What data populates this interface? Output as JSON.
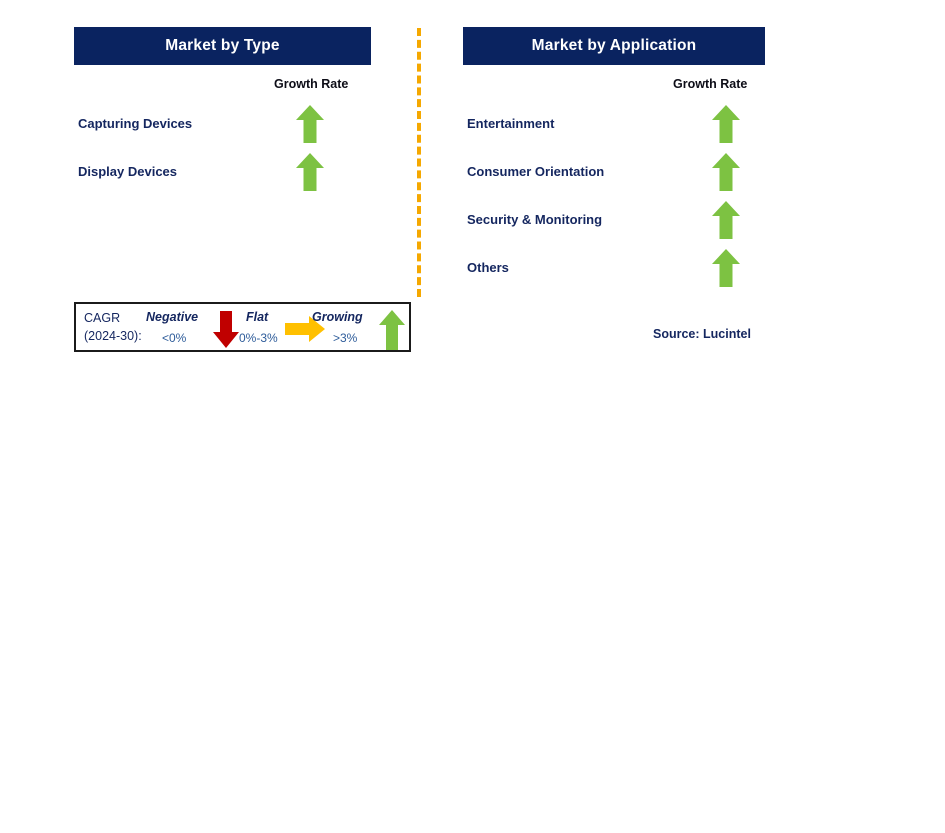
{
  "panels": [
    {
      "title": "Market by Type",
      "growth_rate_caption": "Growth Rate",
      "items": [
        {
          "label": "Capturing Devices",
          "trend": "growing",
          "trend_icon": "up-arrow-icon"
        },
        {
          "label": "Display Devices",
          "trend": "growing",
          "trend_icon": "up-arrow-icon"
        }
      ]
    },
    {
      "title": "Market by Application",
      "growth_rate_caption": "Growth Rate",
      "items": [
        {
          "label": "Entertainment",
          "trend": "growing",
          "trend_icon": "up-arrow-icon"
        },
        {
          "label": "Consumer Orientation",
          "trend": "growing",
          "trend_icon": "up-arrow-icon"
        },
        {
          "label": "Security & Monitoring",
          "trend": "growing",
          "trend_icon": "up-arrow-icon"
        },
        {
          "label": "Others",
          "trend": "growing",
          "trend_icon": "up-arrow-icon"
        }
      ]
    }
  ],
  "legend": {
    "cagr_line1": "CAGR",
    "cagr_line2": "(2024-30):",
    "entries": [
      {
        "title": "Negative",
        "value": "<0%",
        "icon": "down-arrow-icon",
        "color": "#C00000"
      },
      {
        "title": "Flat",
        "value": "0%-3%",
        "icon": "right-arrow-icon",
        "color": "#FFC000"
      },
      {
        "title": "Growing",
        "value": ">3%",
        "icon": "up-arrow-icon",
        "color": "#7DC242"
      }
    ]
  },
  "source": "Source: Lucintel",
  "colors": {
    "header_navy": "#0A2360",
    "label_navy": "#14265f",
    "growing_green": "#7DC242",
    "negative_red": "#C00000",
    "flat_yellow": "#FFC000",
    "divider_orange": "#F5A800",
    "legend_value_blue": "#2E5C9A"
  },
  "chart_data": {
    "type": "table",
    "title": "Market Segmentation Growth Rate Outlook",
    "columns": [
      "Segment",
      "Growth Rate"
    ],
    "groups": [
      {
        "name": "Market by Type",
        "rows": [
          {
            "segment": "Capturing Devices",
            "growth_rate": "growing",
            "cagr_band": ">3%"
          },
          {
            "segment": "Display Devices",
            "growth_rate": "growing",
            "cagr_band": ">3%"
          }
        ]
      },
      {
        "name": "Market by Application",
        "rows": [
          {
            "segment": "Entertainment",
            "growth_rate": "growing",
            "cagr_band": ">3%"
          },
          {
            "segment": "Consumer Orientation",
            "growth_rate": "growing",
            "cagr_band": ">3%"
          },
          {
            "segment": "Security & Monitoring",
            "growth_rate": "growing",
            "cagr_band": ">3%"
          },
          {
            "segment": "Others",
            "growth_rate": "growing",
            "cagr_band": ">3%"
          }
        ]
      }
    ],
    "legend_bands": [
      {
        "label": "Negative",
        "range": "<0%"
      },
      {
        "label": "Flat",
        "range": "0%-3%"
      },
      {
        "label": "Growing",
        "range": ">3%"
      }
    ],
    "period": "2024-30",
    "source": "Lucintel"
  }
}
